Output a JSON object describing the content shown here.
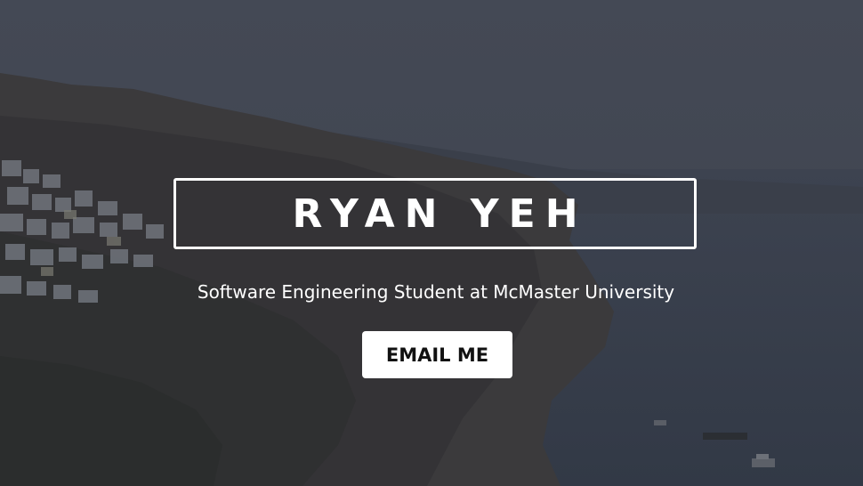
{
  "hero": {
    "title": "RYAN YEH",
    "subtitle": "Software Engineering Student at McMaster University",
    "email_button": "EMAIL ME",
    "background": "coastal cliffside village photo with dark overlay"
  },
  "colors": {
    "overlay": "#3b404b",
    "text": "#ffffff",
    "button_bg": "#ffffff",
    "button_text": "#111111"
  }
}
